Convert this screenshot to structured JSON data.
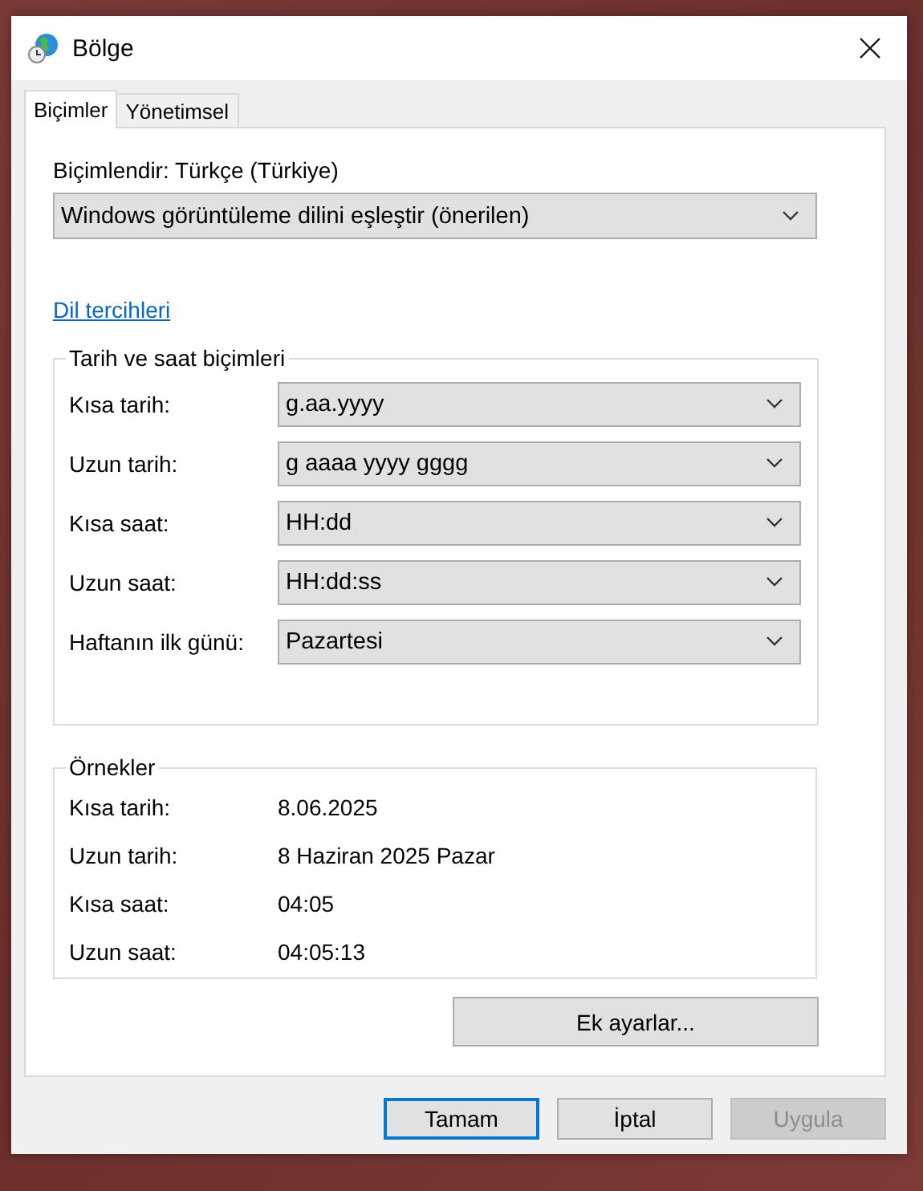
{
  "window": {
    "title": "Bölge"
  },
  "tabs": [
    {
      "label": "Biçimler",
      "selected": true
    },
    {
      "label": "Yönetimsel",
      "selected": false
    }
  ],
  "format": {
    "label": "Biçimlendir: Türkçe (Türkiye)",
    "value": "Windows görüntüleme dilini eşleştir (önerilen)"
  },
  "language_link": "Dil tercihleri",
  "date_time_formats": {
    "title": "Tarih ve saat biçimleri",
    "rows": [
      {
        "label": "Kısa tarih:",
        "value": "g.aa.yyyy"
      },
      {
        "label": "Uzun tarih:",
        "value": "g aaaa yyyy gggg"
      },
      {
        "label": "Kısa saat:",
        "value": "HH:dd"
      },
      {
        "label": "Uzun saat:",
        "value": "HH:dd:ss"
      },
      {
        "label": "Haftanın ilk günü:",
        "value": "Pazartesi"
      }
    ]
  },
  "examples": {
    "title": "Örnekler",
    "rows": [
      {
        "label": "Kısa tarih:",
        "value": "8.06.2025"
      },
      {
        "label": "Uzun tarih:",
        "value": "8 Haziran 2025 Pazar"
      },
      {
        "label": "Kısa saat:",
        "value": "04:05"
      },
      {
        "label": "Uzun saat:",
        "value": "04:05:13"
      }
    ]
  },
  "additional_settings_button": "Ek ayarlar...",
  "buttons": [
    {
      "label": "Tamam",
      "default": true,
      "disabled": false
    },
    {
      "label": "İptal",
      "default": false,
      "disabled": false
    },
    {
      "label": "Uygula",
      "default": false,
      "disabled": true
    }
  ]
}
